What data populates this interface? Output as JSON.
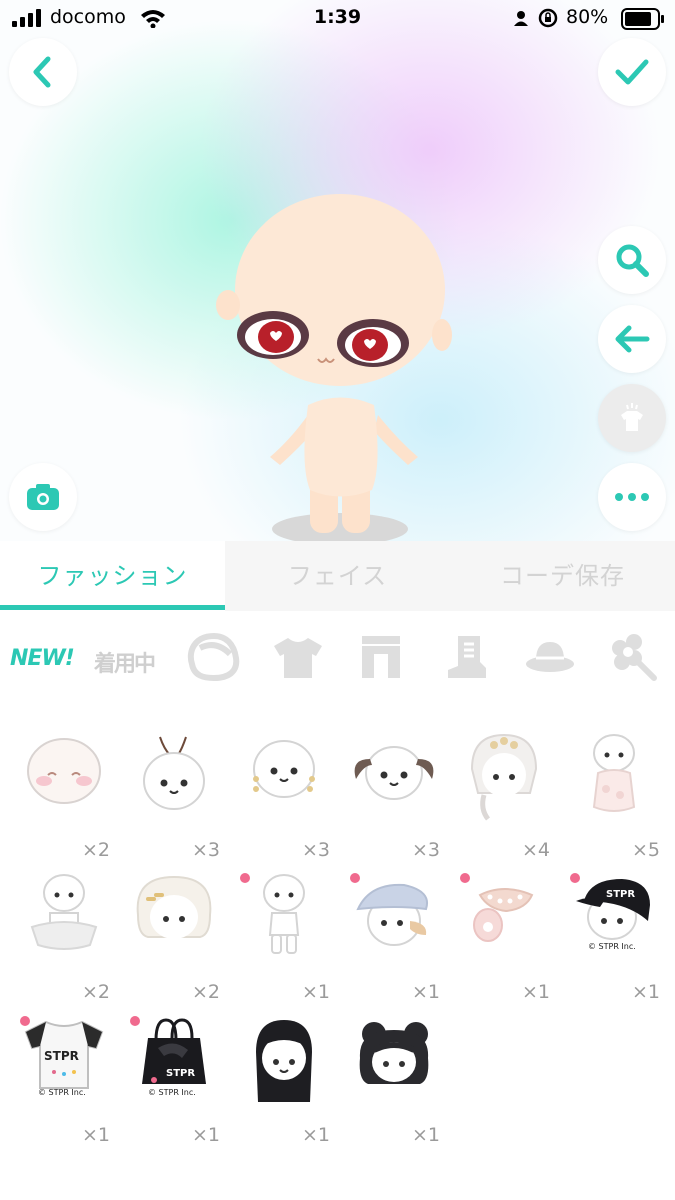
{
  "status_bar": {
    "carrier": "docomo",
    "time": "1:39",
    "battery": "80%"
  },
  "tabs": [
    {
      "label": "ファッション",
      "active": true
    },
    {
      "label": "フェイス",
      "active": false
    },
    {
      "label": "コーデ保存",
      "active": false
    }
  ],
  "categories": [
    {
      "label": "NEW!",
      "icon": "new-label"
    },
    {
      "label": "着用中",
      "icon": "wearing-label"
    },
    {
      "label": "",
      "icon": "hair-icon"
    },
    {
      "label": "",
      "icon": "shirt-icon"
    },
    {
      "label": "",
      "icon": "pants-icon"
    },
    {
      "label": "",
      "icon": "shoes-icon"
    },
    {
      "label": "",
      "icon": "hat-icon"
    },
    {
      "label": "",
      "icon": "accessory-icon"
    }
  ],
  "items": [
    {
      "name": "blush-face",
      "count": "×2",
      "new": false
    },
    {
      "name": "antenna-hair",
      "count": "×3",
      "new": false
    },
    {
      "name": "earrings",
      "count": "×3",
      "new": false
    },
    {
      "name": "twin-tail-hair",
      "count": "×3",
      "new": false
    },
    {
      "name": "flower-hair",
      "count": "×4",
      "new": false
    },
    {
      "name": "frill-outfit",
      "count": "×5",
      "new": false
    },
    {
      "name": "tutu-outfit",
      "count": "×2",
      "new": false
    },
    {
      "name": "bob-hair-clips",
      "count": "×2",
      "new": false
    },
    {
      "name": "white-body",
      "count": "×1",
      "new": true
    },
    {
      "name": "beret",
      "count": "×1",
      "new": true
    },
    {
      "name": "pearl-collar",
      "count": "×1",
      "new": true
    },
    {
      "name": "stpr-cap",
      "count": "×1",
      "new": true,
      "copyright": "© STPR Inc."
    },
    {
      "name": "stpr-tshirt",
      "count": "×1",
      "new": true,
      "copyright": "© STPR Inc."
    },
    {
      "name": "stpr-bag",
      "count": "×1",
      "new": true,
      "copyright": "© STPR Inc."
    },
    {
      "name": "long-black-hair",
      "count": "×1",
      "new": false
    },
    {
      "name": "curly-black-hair",
      "count": "×1",
      "new": false
    }
  ],
  "colors": {
    "accent": "#2cc8b4",
    "new_dot": "#f06a8e",
    "inactive_tab": "#d3d3d3"
  }
}
